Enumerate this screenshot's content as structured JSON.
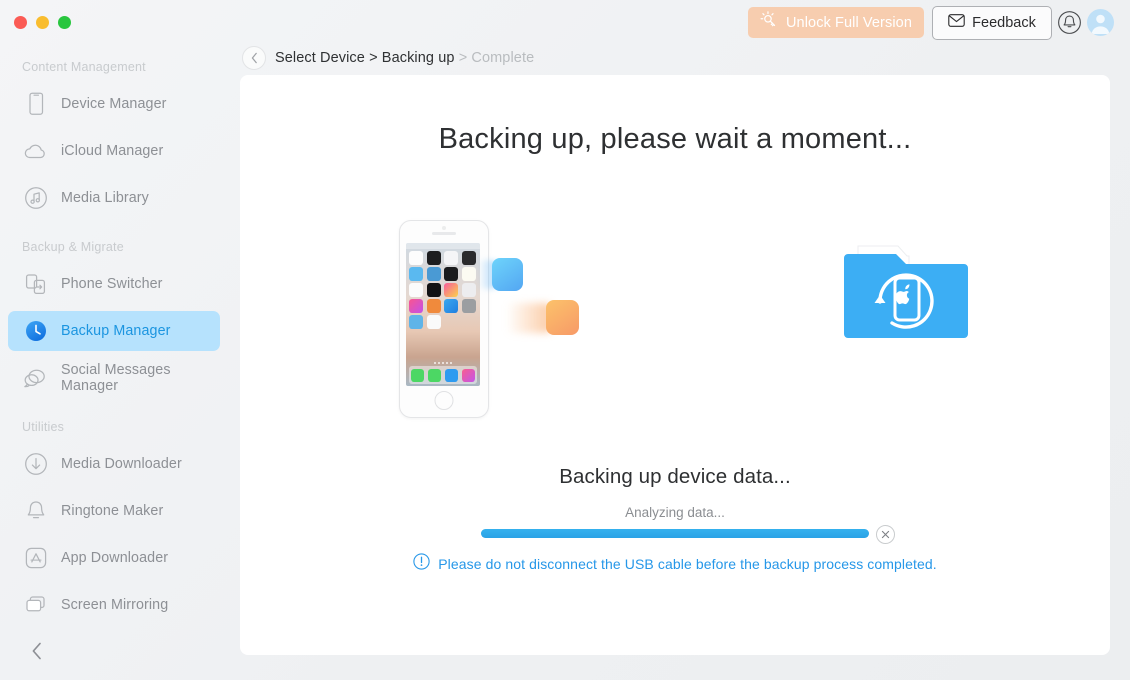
{
  "window": {
    "traffic_lights": [
      "close",
      "minimize",
      "zoom"
    ]
  },
  "topbar": {
    "unlock_label": "Unlock Full Version",
    "unlock_icon": "key-icon",
    "unlock_color": "#f7cdaf",
    "feedback_label": "Feedback",
    "feedback_icon": "envelope-icon",
    "notification_icon": "bell-icon",
    "avatar_icon": "user-avatar-icon"
  },
  "breadcrumb": {
    "back_icon": "chevron-left-icon",
    "step1": "Select Device >",
    "step2": "Backing up",
    "step3": "> Complete"
  },
  "sidebar": {
    "sections": [
      {
        "title": "Content Management",
        "items": [
          {
            "label": "Device Manager",
            "icon": "phone-outline-icon",
            "active": false
          },
          {
            "label": "iCloud Manager",
            "icon": "cloud-icon",
            "active": false
          },
          {
            "label": "Media Library",
            "icon": "music-note-circle-icon",
            "active": false
          }
        ]
      },
      {
        "title": "Backup & Migrate",
        "items": [
          {
            "label": "Phone Switcher",
            "icon": "phone-transfer-icon",
            "active": false
          },
          {
            "label": "Backup Manager",
            "icon": "clock-icon",
            "active": true
          },
          {
            "label": "Social Messages Manager",
            "icon": "chat-bubbles-icon",
            "active": false
          }
        ]
      },
      {
        "title": "Utilities",
        "items": [
          {
            "label": "Media Downloader",
            "icon": "download-circle-icon",
            "active": false
          },
          {
            "label": "Ringtone Maker",
            "icon": "bell-outline-icon",
            "active": false
          },
          {
            "label": "App Downloader",
            "icon": "app-store-icon",
            "active": false
          },
          {
            "label": "Screen Mirroring",
            "icon": "screens-icon",
            "active": false
          }
        ]
      }
    ],
    "collapse_icon": "chevron-left-icon",
    "active_bg": "#b6e2fd",
    "active_text": "#1b95e0"
  },
  "main": {
    "heading": "Backing up, please wait a moment...",
    "illustration": {
      "device_icon": "iphone-home-screen-icon",
      "transfer_block_blue": "data-block-blue",
      "transfer_block_orange": "data-block-orange",
      "target_icon": "backup-folder-icon"
    },
    "status_title": "Backing up device data...",
    "status_sub": "Analyzing data...",
    "progress_percent": 100,
    "progress_color": "#2aa2e6",
    "cancel_icon": "close-circle-icon",
    "notice_icon": "info-exclamation-icon",
    "notice_text": "Please do not disconnect the USB cable before the backup process completed."
  }
}
